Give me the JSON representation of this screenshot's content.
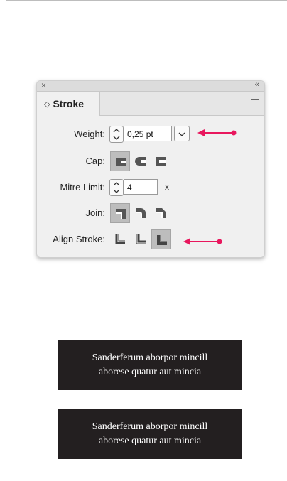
{
  "panel": {
    "tab_label": "Stroke",
    "weight": {
      "label": "Weight:",
      "value": "0,25 pt"
    },
    "cap": {
      "label": "Cap:",
      "options": [
        "butt-cap-icon",
        "round-cap-icon",
        "projecting-cap-icon"
      ],
      "selected": 0
    },
    "mitre": {
      "label": "Mitre Limit:",
      "value": "4",
      "unit": "x"
    },
    "join": {
      "label": "Join:",
      "options": [
        "miter-join-icon",
        "round-join-icon",
        "bevel-join-icon"
      ],
      "selected": 0
    },
    "align": {
      "label": "Align Stroke:",
      "options": [
        "align-center-icon",
        "align-inside-icon",
        "align-outside-icon"
      ],
      "selected": 2
    }
  },
  "annotation_color": "#e8175d",
  "boxes": [
    {
      "text_line1": "Sanderferum aborpor mincill",
      "text_line2": "aborese quatur aut mincia"
    },
    {
      "text_line1": "Sanderferum aborpor mincill",
      "text_line2": "aborese quatur aut mincia"
    }
  ]
}
